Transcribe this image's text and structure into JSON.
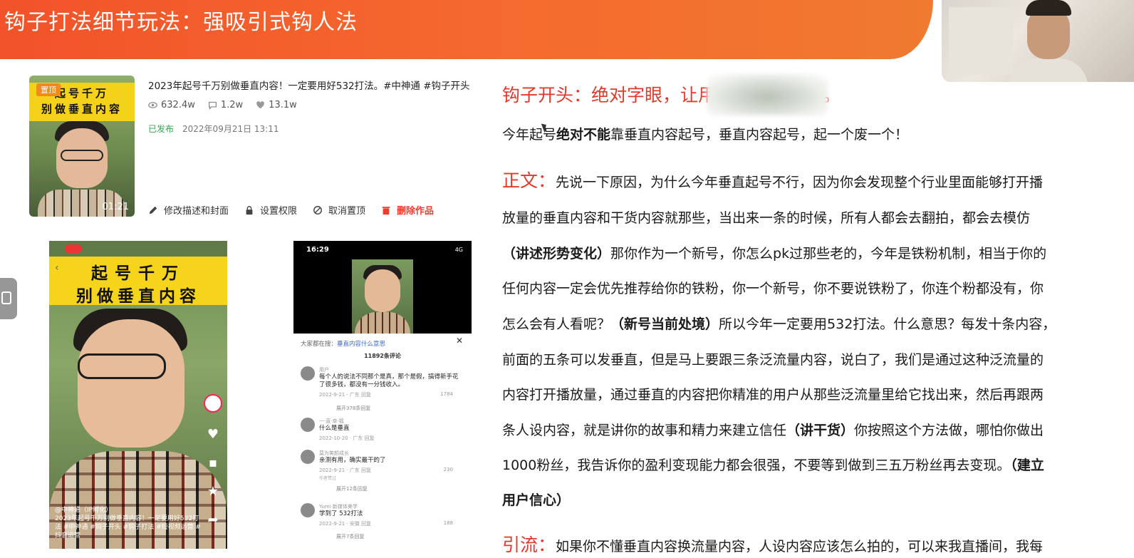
{
  "header": {
    "title": "钩子打法细节玩法：强吸引式钩人法"
  },
  "post": {
    "pin_badge": "置顶",
    "thumb_line1": "起号千万",
    "thumb_line2": "别做垂直内容",
    "duration": "01:21",
    "title": "2023年起号千万别做垂直内容！一定要用好532打法。#中神通 #钩子开头",
    "views": "632.4w",
    "comments": "1.2w",
    "likes": "13.1w",
    "status": "已发布",
    "published_at": "2022年09月21日 13:11",
    "actions": {
      "edit": "修改描述和封面",
      "permission": "设置权限",
      "unpin": "取消置顶",
      "delete": "删除作品"
    }
  },
  "phone1": {
    "banner_line1": "起号千万",
    "banner_line2": "别做垂直内容",
    "caption_user": "@中神通（IP孵化）",
    "caption_text": "2023年起号千万别做垂直内容！一定要用好532打法 #中神通 #钩子开头 #钩子打法 #短视频运营 #抖音运营"
  },
  "phone2": {
    "time": "16:29",
    "signal": "4G",
    "search_prefix": "大家都在搜：",
    "search_term": "垂直内容什么意思",
    "comment_count": "11892条评论",
    "comments": [
      {
        "name": "用户",
        "text": "每个人的说法不同那个是真，那个是假，搞得新手花了很多钱，都没有一分钱收入。",
        "meta": "2022-9-21 · 广东   回复",
        "likes": "1784",
        "expand": "展开378条回复"
      },
      {
        "name": "一·直·幸·福",
        "text": "什么是垂直",
        "meta": "2022-10-20 · 广东   回复",
        "likes": "",
        "expand": ""
      },
      {
        "name": "莫为笑颜成长",
        "text": "亲测有用，确实最干的了",
        "meta": "2022-9-21 · 广东   回复",
        "likes": "230",
        "expand": "展开12条回复",
        "tag": "作者赞过"
      },
      {
        "name": "Yumi·新媒体美学",
        "text": "学到了 532打法",
        "meta": "2022-9-21 · 安徽   回复",
        "likes": "188",
        "expand": "展开7条回复"
      }
    ]
  },
  "article": {
    "hook_title": "钩子开头：绝对字眼，让用户选择往下看。",
    "intro_pre": "今年起号",
    "intro_bold": "绝对不能",
    "intro_post": "靠垂直内容起号，垂直内容起号，起一个废一个！",
    "body_label": "正文：",
    "body_l1": "先说一下原因，为什么今年垂直起号不行，因为你会发现整个行业里面能够打开播",
    "body_l2": "放量的垂直内容和干货内容就那些，当出来一条的时候，所有人都会去翻拍，都会去模仿",
    "body_l3_bold": "（讲述形势变化）",
    "body_l3": "那你作为一个新号，你怎么pk过那些老的，今年是铁粉机制，相当于你的",
    "body_l4": "任何内容一定会优先推荐给你的铁粉，你一个新号，你不要说铁粉了，你连个粉都没有，你",
    "body_l5_pre": "怎么会有人看呢？",
    "body_l5_bold": "（新号当前处境）",
    "body_l5_post": "所以今年一定要用532打法。什么意思？每发十条内容，",
    "body_l6": "前面的五条可以发垂直，但是马上要跟三条泛流量内容，说白了，我们是通过这种泛流量的",
    "body_l7": "内容打开播放量，通过垂直的内容把你精准的用户从那些泛流量里给它找出来，然后再跟两",
    "body_l8_pre": "条人设内容，就是讲你的故事和精力来建立信任",
    "body_l8_bold": "（讲干货）",
    "body_l8_post": "你按照这个方法做，哪怕你做出",
    "body_l9_pre": "1000粉丝，我告诉你的盈利变现能力都会很强，不要等到做到三五万粉丝再去变现。",
    "body_l9_bold": "（建立",
    "body_l10_bold": "用户信心）",
    "traffic_label": "引流：",
    "traffic_text": "如果你不懂垂直内容换流量内容，人设内容应该怎么拍的，可以来我直播间，我每"
  },
  "colors": {
    "header": "#f2532a",
    "accent_red": "#e0392b",
    "published_green": "#33a852"
  }
}
